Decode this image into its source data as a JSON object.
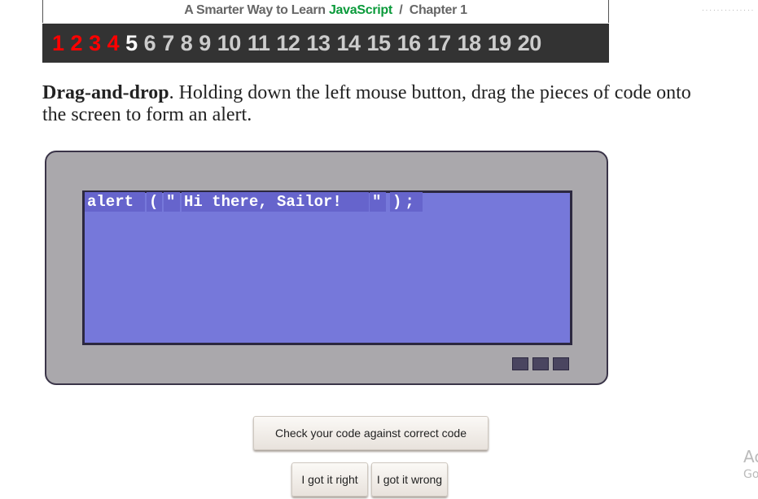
{
  "header": {
    "prefix": "A Smarter Way to Learn",
    "brand": "JavaScript",
    "separator": "/",
    "chapter": "Chapter 1"
  },
  "nav": {
    "completed": [
      "1",
      "2",
      "3",
      "4"
    ],
    "current": "5",
    "upcoming": [
      "6",
      "7",
      "8",
      "9",
      "10",
      "11",
      "12",
      "13",
      "14",
      "15",
      "16",
      "17",
      "18",
      "19",
      "20"
    ]
  },
  "instructions": {
    "bold": "Drag-and-drop",
    "text": ". Holding down the left mouse button, drag the pieces of code onto the screen to form an alert."
  },
  "code_pieces": [
    "alert",
    "(",
    "\"",
    "Hi there, Sailor!",
    "\"",
    ");"
  ],
  "buttons": {
    "check": "Check your code against correct code",
    "right": "I got it right",
    "wrong": "I got it wrong"
  },
  "watermark": {
    "line1": "Ac",
    "line2": "Go"
  },
  "colors": {
    "done": "#ff0000",
    "brand": "#0a9a3a",
    "screen": "#7678da"
  }
}
